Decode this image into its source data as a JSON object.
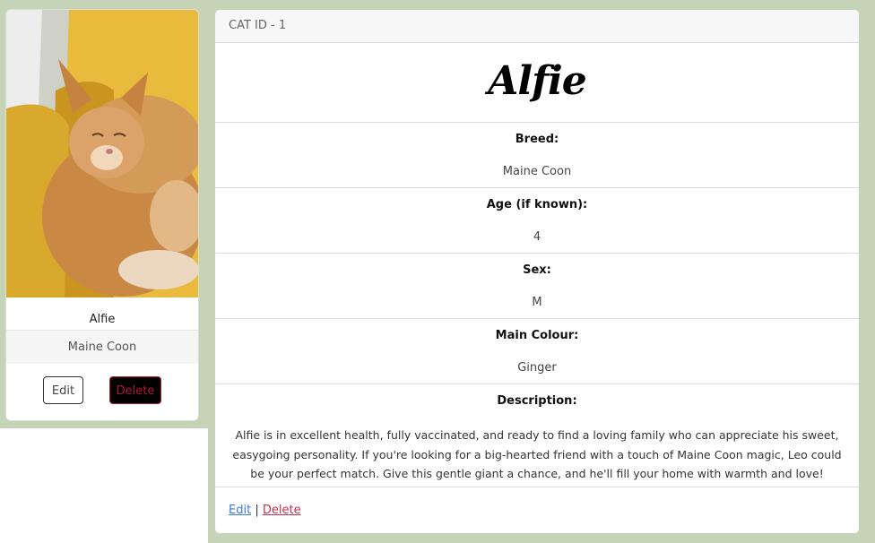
{
  "card": {
    "name": "Alfie",
    "breed": "Maine Coon",
    "edit_label": "Edit",
    "delete_label": "Delete"
  },
  "detail": {
    "header": "CAT ID - 1",
    "title": "Alfie",
    "fields": [
      {
        "label": "Breed:",
        "value": "Maine Coon"
      },
      {
        "label": "Age (if known):",
        "value": "4"
      },
      {
        "label": "Sex:",
        "value": "M"
      },
      {
        "label": "Main Colour:",
        "value": "Ginger"
      }
    ],
    "description_label": "Description:",
    "description": "Alfie is in excellent health, fully vaccinated, and ready to find a loving family who can appreciate his sweet, easygoing personality. If you're looking for a big-hearted friend with a touch of Maine Coon magic, Leo could be your perfect match. Give this gentle giant a chance, and he'll fill your home with warmth and love!",
    "footer": {
      "edit_label": "Edit",
      "separator": "|",
      "delete_label": "Delete"
    }
  },
  "colors": {
    "page_background": "#c5d3b7",
    "edit_link": "#3a7bd5",
    "delete_link": "#c0314f",
    "delete_button_text": "#b01735"
  }
}
